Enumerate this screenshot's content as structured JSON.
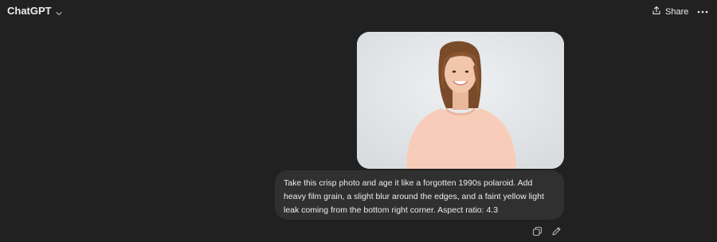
{
  "header": {
    "model_name": "ChatGPT",
    "share_label": "Share"
  },
  "message": {
    "text": "Take this crisp photo and age it like a forgotten 1990s polaroid. Add heavy film grain, a slight blur around the edges, and a faint yellow light leak coming from the bottom right corner. Aspect ratio: 4.3"
  },
  "icons": {
    "model_dropdown": "chevron-down-icon",
    "share": "share-icon",
    "more": "more-horizontal-icon",
    "copy": "copy-icon",
    "edit": "edit-pencil-icon"
  },
  "colors": {
    "background": "#212121",
    "bubble": "#303030",
    "text": "#ececec",
    "sweater": "#f7cdb9",
    "photo_background": "#e6e8ea"
  }
}
